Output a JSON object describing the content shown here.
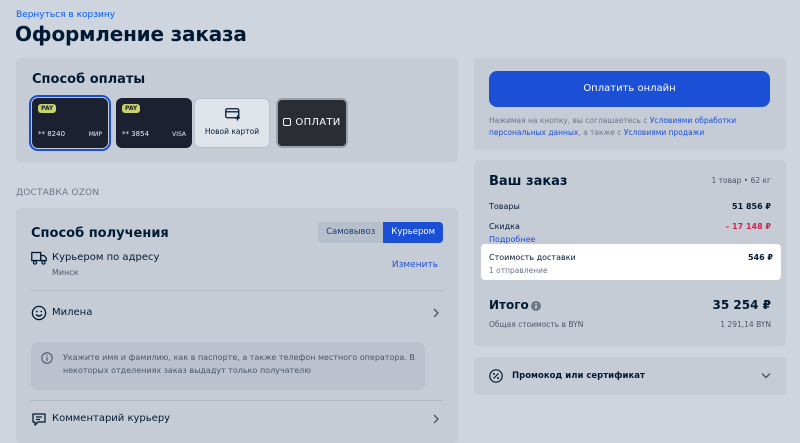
{
  "header": {
    "back_link": "Вернуться в корзину",
    "title": "Оформление заказа"
  },
  "payment": {
    "title": "Способ оплаты",
    "options": [
      {
        "badge": "PAY",
        "number": "** 8240",
        "system": "МИР",
        "selected": true
      },
      {
        "badge": "PAY",
        "number": "** 3854",
        "system": "VISA",
        "selected": false
      }
    ],
    "new_card_label": "Новой картой",
    "oplati_label": "ОПЛАТИ"
  },
  "delivery_section_label": "ДОСТАВКА OZON",
  "delivery": {
    "title": "Способ получения",
    "toggle": {
      "pickup": "Самовывоз",
      "courier": "Курьером"
    },
    "address_title": "Курьером по адресу",
    "city": "Минск",
    "change_link": "Изменить",
    "recipient": "Милена",
    "info": "Укажите имя и фамилию, как в паспорте, а также телефон местного оператора. В некоторых отделениях заказ выдадут только получателю",
    "comment": "Комментарий курьеру"
  },
  "checkout": {
    "pay_button": "Оплатить онлайн",
    "terms_prefix": "Нажимая на кнопку, вы соглашаетесь с ",
    "terms_link1": "Условиями обработки персональных данных",
    "terms_mid": ", а также с ",
    "terms_link2": "Условиями продажи"
  },
  "order": {
    "title": "Ваш заказ",
    "meta": "1 товар • 62 кг",
    "goods_label": "Товары",
    "goods_value": "51 856 ₽",
    "discount_label": "Скидка",
    "discount_value": "- 17 148 ₽",
    "more_link": "Подробнее",
    "delivery_label": "Стоимость доставки",
    "delivery_sub": "1 отправление",
    "delivery_value": "546 ₽",
    "total_label": "Итого",
    "total_value": "35 254 ₽",
    "byn_label": "Общая стоимость в BYN",
    "byn_value": "1 291,14 BYN"
  },
  "promo": {
    "label": "Промокод или сертификат"
  },
  "colors": {
    "accent": "#1a4fd6",
    "discount": "#d5234a",
    "page_bg": "#cfd5de"
  }
}
